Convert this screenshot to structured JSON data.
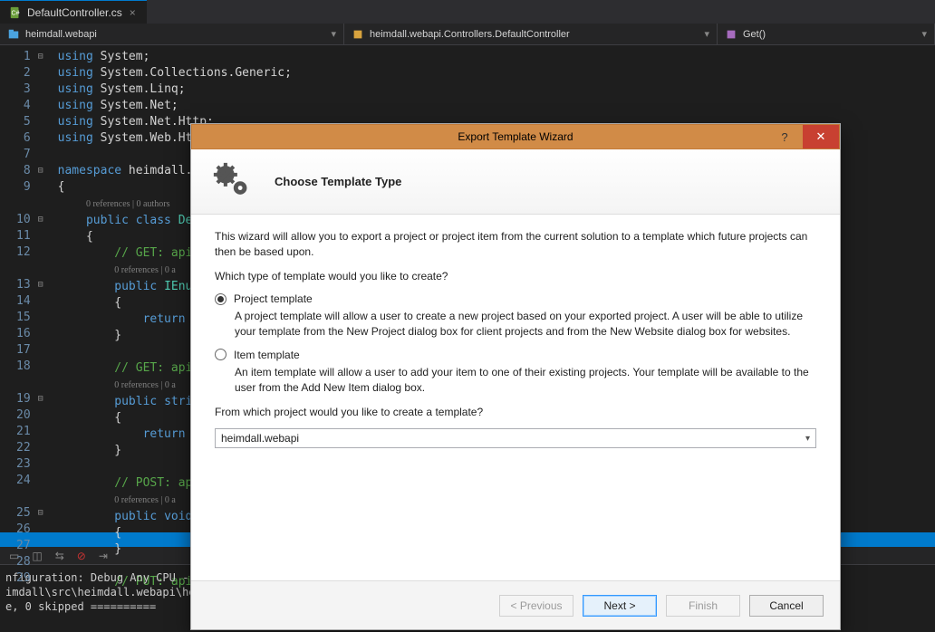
{
  "tab": {
    "filename": "DefaultController.cs"
  },
  "context": {
    "item1": "heimdall.webapi",
    "item2": "heimdall.webapi.Controllers.DefaultController",
    "item3": "Get()"
  },
  "code": {
    "lines": [
      "using System;",
      "using System.Collections.Generic;",
      "using System.Linq;",
      "using System.Net;",
      "using System.Net.Http;",
      "using System.Web.Http;",
      "",
      "namespace heimdall.w",
      "{",
      "0 references | 0 authors",
      "    public class Def",
      "    {",
      "        // GET: api/",
      "        0 references | 0 a",
      "        public IEnum",
      "        {",
      "            return n",
      "        }",
      "",
      "        // GET: api/",
      "        0 references | 0 a",
      "        public strin",
      "        {",
      "            return \"",
      "        }",
      "",
      "        // POST: api",
      "        0 references | 0 a",
      "        public void ",
      "        {",
      "        }",
      "",
      "        // PUT: api/"
    ]
  },
  "output": {
    "line1": "nfiguration: Debug Any CPU ---",
    "line2": "imdall\\src\\heimdall.webapi\\hei",
    "line3": "e, 0 skipped =========="
  },
  "dialog": {
    "title": "Export Template Wizard",
    "header": "Choose Template Type",
    "intro": "This wizard will allow you to export a project or project item from the current solution to a template which future projects can then be based upon.",
    "question": "Which type of template would you like to create?",
    "opt1_label": "Project template",
    "opt1_desc": "A project template will allow a user to create a new project based on your exported project. A user will be able to utilize your template from the New Project dialog box for client projects and from the New Website dialog box for websites.",
    "opt2_label": "Item template",
    "opt2_desc": "An item template will allow a user to add your item to one of their existing projects. Your template will be available to the user from the Add New Item dialog box.",
    "project_question": "From which project would you like to create a template?",
    "project_value": "heimdall.webapi",
    "btn_prev": "< Previous",
    "btn_next": "Next >",
    "btn_finish": "Finish",
    "btn_cancel": "Cancel"
  }
}
